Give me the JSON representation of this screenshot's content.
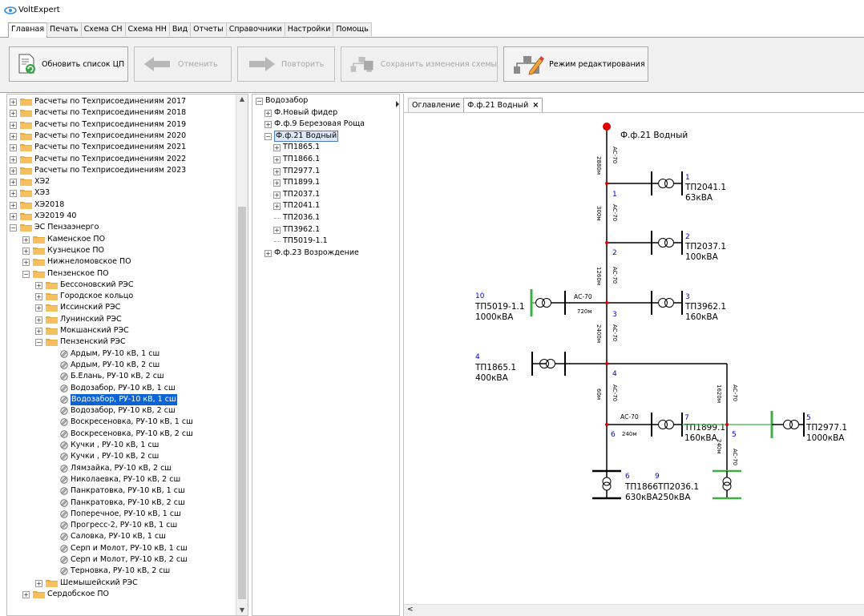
{
  "app": {
    "title": "VoltExpert"
  },
  "menu_tabs": [
    "Главная",
    "Печать",
    "Схема СН",
    "Схема НН",
    "Вид",
    "Отчеты",
    "Справочники",
    "Настройки",
    "Помощь"
  ],
  "ribbon": {
    "refresh_label": "Обновить список ЦП",
    "undo_label": "Отменить",
    "redo_label": "Повторить",
    "save_label": "Сохранить изменения схемы",
    "edit_mode_label": "Режим редактирования"
  },
  "left_tree": [
    {
      "label": "Расчеты по Техприсоединениям 2017",
      "level": 0,
      "type": "folder",
      "state": "+"
    },
    {
      "label": "Расчеты по Техприсоединениям 2018",
      "level": 0,
      "type": "folder",
      "state": "+"
    },
    {
      "label": "Расчеты по Техприсоединениям 2019",
      "level": 0,
      "type": "folder",
      "state": "+"
    },
    {
      "label": "Расчеты по Техприсоединениям 2020",
      "level": 0,
      "type": "folder",
      "state": "+"
    },
    {
      "label": "Расчеты по Техприсоединениям 2021",
      "level": 0,
      "type": "folder",
      "state": "+"
    },
    {
      "label": "Расчеты по Техприсоединениям 2022",
      "level": 0,
      "type": "folder",
      "state": "+"
    },
    {
      "label": "Расчеты по Техприсоединениям 2023",
      "level": 0,
      "type": "folder",
      "state": "+"
    },
    {
      "label": "ХЭ2",
      "level": 0,
      "type": "folder",
      "state": "+"
    },
    {
      "label": "ХЭ3",
      "level": 0,
      "type": "folder",
      "state": "+"
    },
    {
      "label": "ХЭ2018",
      "level": 0,
      "type": "folder",
      "state": "+"
    },
    {
      "label": "ХЭ2019 40",
      "level": 0,
      "type": "folder",
      "state": "+"
    },
    {
      "label": "ЭС Пензаэнерго",
      "level": 0,
      "type": "folder",
      "state": "-"
    },
    {
      "label": "Каменское ПО",
      "level": 1,
      "type": "folder",
      "state": "+"
    },
    {
      "label": "Кузнецкое ПО",
      "level": 1,
      "type": "folder",
      "state": "+"
    },
    {
      "label": "Нижнеломовское ПО",
      "level": 1,
      "type": "folder",
      "state": "+"
    },
    {
      "label": "Пензенское ПО",
      "level": 1,
      "type": "folder",
      "state": "-"
    },
    {
      "label": "Бессоновский РЭС",
      "level": 2,
      "type": "folder",
      "state": "+"
    },
    {
      "label": "Городское кольцо",
      "level": 2,
      "type": "folder",
      "state": "+"
    },
    {
      "label": "Иссинский РЭС",
      "level": 2,
      "type": "folder",
      "state": "+"
    },
    {
      "label": "Лунинский РЭС",
      "level": 2,
      "type": "folder",
      "state": "+"
    },
    {
      "label": "Мокшанский РЭС",
      "level": 2,
      "type": "folder",
      "state": "+"
    },
    {
      "label": "Пензенский РЭС",
      "level": 2,
      "type": "folder",
      "state": "-"
    },
    {
      "label": "Ардым, РУ-10 кВ, 1 сш",
      "level": 3,
      "type": "leaf"
    },
    {
      "label": "Ардым, РУ-10 кВ, 2 сш",
      "level": 3,
      "type": "leaf"
    },
    {
      "label": "Б.Елань, РУ-10 кВ, 2 сш",
      "level": 3,
      "type": "leaf"
    },
    {
      "label": "Водозабор, РУ-10 кВ, 1 сш",
      "level": 3,
      "type": "leaf"
    },
    {
      "label": "Водозабор, РУ-10 кВ, 1 сш",
      "level": 3,
      "type": "leaf",
      "selected": true
    },
    {
      "label": "Водозабор, РУ-10 кВ, 2 сш",
      "level": 3,
      "type": "leaf"
    },
    {
      "label": "Воскресеновка, РУ-10 кВ, 1 сш",
      "level": 3,
      "type": "leaf"
    },
    {
      "label": "Воскресеновка, РУ-10 кВ, 2 сш",
      "level": 3,
      "type": "leaf"
    },
    {
      "label": "Кучки , РУ-10 кВ, 1 сш",
      "level": 3,
      "type": "leaf"
    },
    {
      "label": "Кучки , РУ-10 кВ, 2 сш",
      "level": 3,
      "type": "leaf"
    },
    {
      "label": "Лямзайка, РУ-10 кВ, 2 сш",
      "level": 3,
      "type": "leaf"
    },
    {
      "label": "Николаевка, РУ-10 кВ, 2 сш",
      "level": 3,
      "type": "leaf"
    },
    {
      "label": "Панкратовка, РУ-10 кВ, 1 сш",
      "level": 3,
      "type": "leaf"
    },
    {
      "label": "Панкратовка, РУ-10 кВ, 2 сш",
      "level": 3,
      "type": "leaf"
    },
    {
      "label": "Поперечное, РУ-10 кВ, 1 сш",
      "level": 3,
      "type": "leaf"
    },
    {
      "label": "Прогресс-2, РУ-10 кВ, 1 сш",
      "level": 3,
      "type": "leaf"
    },
    {
      "label": "Саловка, РУ-10 кВ, 1 сш",
      "level": 3,
      "type": "leaf"
    },
    {
      "label": "Серп и Молот, РУ-10 кВ, 1 сш",
      "level": 3,
      "type": "leaf"
    },
    {
      "label": "Серп и Молот, РУ-10 кВ, 2 сш",
      "level": 3,
      "type": "leaf"
    },
    {
      "label": "Терновка, РУ-10 кВ, 2 сш",
      "level": 3,
      "type": "leaf"
    },
    {
      "label": "Шемышейский РЭС",
      "level": 2,
      "type": "folder",
      "state": "+"
    },
    {
      "label": "Сердобское ПО",
      "level": 1,
      "type": "folder",
      "state": "+"
    }
  ],
  "mid_tree": [
    {
      "label": "Водозабор",
      "level": 0,
      "state": "-"
    },
    {
      "label": "Ф.Новый фидер",
      "level": 1,
      "state": "+"
    },
    {
      "label": "Ф.ф.9 Березовая Роща",
      "level": 1,
      "state": "+"
    },
    {
      "label": "Ф.ф.21 Водный",
      "level": 1,
      "state": "-",
      "selected": true
    },
    {
      "label": "ТП1865.1",
      "level": 2,
      "state": "+"
    },
    {
      "label": "ТП1866.1",
      "level": 2,
      "state": "+"
    },
    {
      "label": "ТП2977.1",
      "level": 2,
      "state": "+"
    },
    {
      "label": "ТП1899.1",
      "level": 2,
      "state": "+"
    },
    {
      "label": "ТП2037.1",
      "level": 2,
      "state": "+"
    },
    {
      "label": "ТП2041.1",
      "level": 2,
      "state": "+"
    },
    {
      "label": "ТП2036.1",
      "level": 2,
      "state": ""
    },
    {
      "label": "ТП3962.1",
      "level": 2,
      "state": "+"
    },
    {
      "label": "ТП5019-1.1",
      "level": 2,
      "state": ""
    },
    {
      "label": "Ф.ф.23 Возрождение",
      "level": 1,
      "state": "+"
    }
  ],
  "doc_tabs": {
    "tab1": "Оглавление",
    "tab2": "Ф.ф.21 Водный",
    "close": "×"
  },
  "scheme": {
    "feeder_title": "Ф.ф.21 Водный",
    "cable": "АС-70",
    "seg_lengths": [
      "2880м",
      "300м",
      "1260м",
      "720м",
      "2400м",
      "60м",
      "1620м",
      "240м",
      "240м"
    ],
    "nodes": [
      "1",
      "2",
      "3",
      "4",
      "5",
      "6"
    ],
    "tp": [
      {
        "num": "1",
        "name": "ТП2041.1",
        "kva": "63кВА"
      },
      {
        "num": "2",
        "name": "ТП2037.1",
        "kva": "100кВА"
      },
      {
        "num": "3",
        "name": "ТП3962.1",
        "kva": "160кВА"
      },
      {
        "num": "10",
        "name": "ТП5019-1.1",
        "kva": "1000кВА"
      },
      {
        "num": "4",
        "name": "ТП1865.1",
        "kva": "400кВА"
      },
      {
        "num": "7",
        "name": "ТП1899.1",
        "kva": "160кВА"
      },
      {
        "num": "5",
        "name": "ТП2977.1",
        "kva": "1000кВА"
      },
      {
        "num": "6",
        "name": "ТП1866.1",
        "kva": "630кВА"
      },
      {
        "num": "9",
        "name": "ТП2036.1",
        "kva": "250кВА"
      }
    ],
    "overlap_text": "ТП1866ТП2036.1",
    "overlap_kva": "630кВА250кВА"
  },
  "colors": {
    "line": "#000000",
    "green": "#3cb043",
    "red": "#e00000",
    "blue": "#0000cc",
    "select": "#0a64d8",
    "folder": "#e8a93a"
  }
}
